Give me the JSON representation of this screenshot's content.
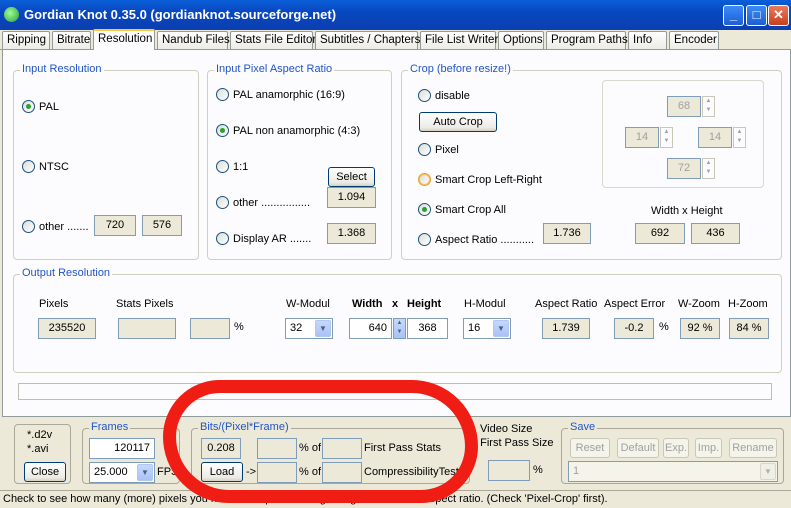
{
  "window": {
    "title": "Gordian Knot 0.35.0  (gordianknot.sourceforge.net)",
    "buttons": {
      "min": "_",
      "max": "□",
      "close": "✕"
    }
  },
  "tabs": [
    "Ripping",
    "Bitrate",
    "Resolution",
    "Nandub Files",
    "Stats File Editor",
    "Subtitles / Chapters",
    "File List Writer",
    "Options",
    "Program Paths",
    "Info",
    "Encoder"
  ],
  "input_resolution": {
    "title": "Input Resolution",
    "pal": "PAL",
    "ntsc": "NTSC",
    "other": "other .......",
    "width": "720",
    "height": "576"
  },
  "par": {
    "title": "Input Pixel Aspect Ratio",
    "anamorphic": "PAL anamorphic (16:9)",
    "non_anamorphic": "PAL non anamorphic (4:3)",
    "one": "1:1",
    "other": "other ................",
    "display_ar": "Display AR .......",
    "select": "Select",
    "other_value": "1.094",
    "dar_value": "1.368"
  },
  "crop": {
    "title": "Crop (before resize!)",
    "disable": "disable",
    "auto": "Auto Crop",
    "pixel": "Pixel",
    "smart_lr": "Smart Crop Left-Right",
    "smart_all": "Smart Crop All",
    "aspect": "Aspect Ratio  ...........",
    "aspect_value": "1.736",
    "top": "68",
    "left": "14",
    "right": "14",
    "bottom": "72",
    "wh_label": "Width x Height",
    "w": "692",
    "h": "436"
  },
  "output": {
    "title": "Output Resolution",
    "pixels_label": "Pixels",
    "stats_label": "Stats Pixels",
    "pixels": "235520",
    "pct": "%",
    "wmodul_label": "W-Modul",
    "width_label": "Width",
    "x": "x",
    "height_label": "Height",
    "hmodul_label": "H-Modul",
    "ar_label": "Aspect Ratio",
    "ae_label": "Aspect Error",
    "wz_label": "W-Zoom",
    "hz_label": "H-Zoom",
    "wmodul": "32",
    "width": "640",
    "height": "368",
    "hmodul": "16",
    "ar": "1.739",
    "ae": "-0.2",
    "ae_pct": "%",
    "wz": "92 %",
    "hz": "84 %"
  },
  "bottom": {
    "d2v": "*.d2v",
    "avi": "*.avi",
    "close": "Close",
    "frames_title": "Frames",
    "frames": "120117",
    "fps": "25.000",
    "fps_label": "FPS",
    "bpp_title": "Bits/(Pixel*Frame)",
    "bpp": "0.208",
    "load": "Load",
    "arrow": "->",
    "pct_of": "% of",
    "first_pass": "First Pass Stats",
    "compress": "CompressibilityTest",
    "video_title": "Video Size",
    "video_sub": "/ First Pass Size",
    "video_pct": "%",
    "save_title": "Save",
    "reset": "Reset",
    "default": "Default",
    "exp": "Exp.",
    "imp": "Imp.",
    "rename": "Rename",
    "save_select": "1"
  },
  "status": "Check to see how many (more) pixels you have to crop left and right to get the correct aspect ratio. (Check 'Pixel-Crop' first)."
}
